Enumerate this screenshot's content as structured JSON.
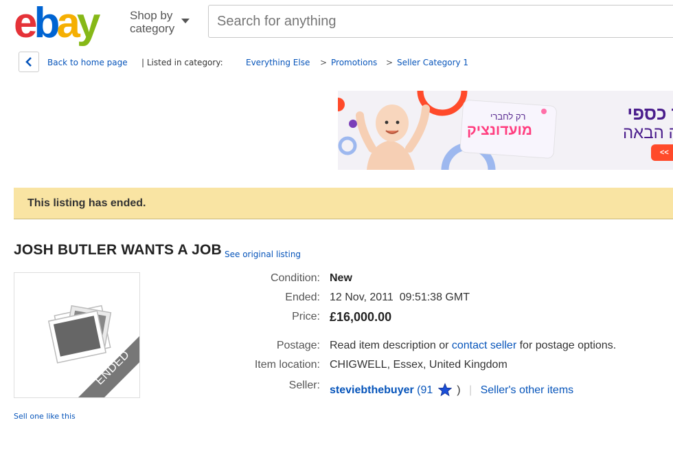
{
  "header": {
    "logo": [
      "e",
      "b",
      "a",
      "y"
    ],
    "logo_colors": [
      "#e53238",
      "#0064d2",
      "#f5af02",
      "#86b817"
    ],
    "shop_by_line1": "Shop by",
    "shop_by_line2": "category",
    "search_placeholder": "Search for anything"
  },
  "breadcrumb": {
    "back": "Back to home page",
    "listed_in": "| Listed in category:",
    "items": [
      "Everything Else",
      "Promotions",
      "Seller Category 1"
    ],
    "separator": ">"
  },
  "banner": {
    "line1": "וזר כספי",
    "line2": "נייה הבאה",
    "card_small": "רק לחברי",
    "card_big": "מועדונציק",
    "cta": "<<"
  },
  "notice": "This listing has ended.",
  "listing": {
    "title": "JOSH BUTLER WANTS A JOB",
    "see_original": "See original listing",
    "ended_badge": "ENDED",
    "sell_one": "Sell one like this",
    "condition_label": "Condition:",
    "condition": "New",
    "ended_label": "Ended:",
    "ended": "12 Nov, 2011  09:51:38 GMT",
    "price_label": "Price:",
    "price": "£16,000.00",
    "postage_label": "Postage:",
    "postage_pre": "Read item description or",
    "postage_link": "contact seller",
    "postage_post": "for postage options.",
    "location_label": "Item location:",
    "location": "CHIGWELL, Essex, United Kingdom",
    "seller_label": "Seller:",
    "seller_name": "steviebthebuyer",
    "seller_score": "(91",
    "seller_close": ")",
    "divider": "|",
    "other_items": "Seller's other items"
  }
}
